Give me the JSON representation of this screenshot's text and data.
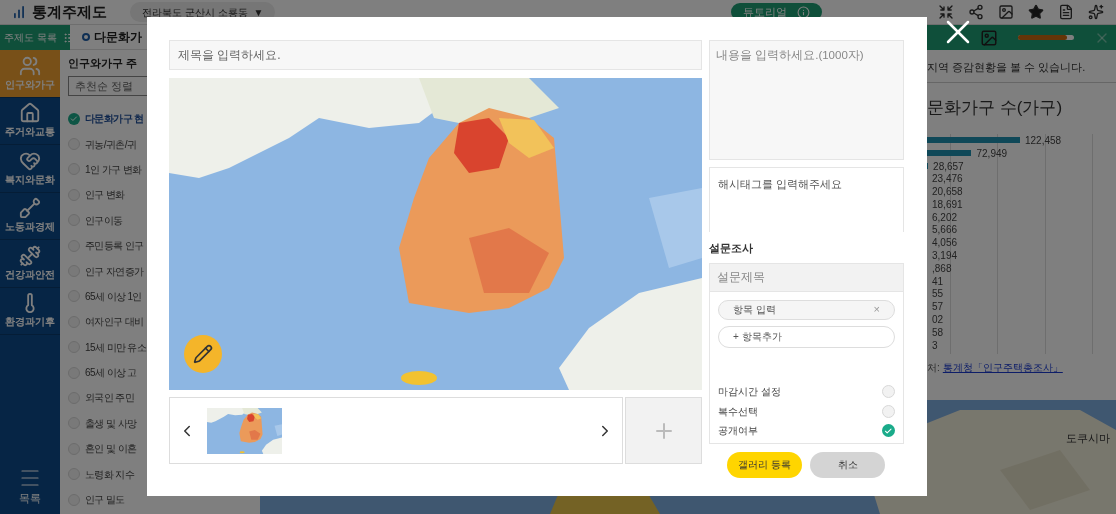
{
  "app": {
    "title": "통계주제도",
    "region": "전라북도 군산시 소룡동",
    "region_caret": "▼",
    "tutorial": "튜토리얼"
  },
  "nav": {
    "list_label": "주제도 목록",
    "tab": "다문화가",
    "menu": "목록",
    "categories": [
      {
        "label": "인구와가구",
        "selected": true,
        "kind": "people"
      },
      {
        "label": "주거와교통",
        "selected": false,
        "kind": "house"
      },
      {
        "label": "복지와문화",
        "selected": false,
        "kind": "welfare"
      },
      {
        "label": "노동과경제",
        "selected": false,
        "kind": "labor"
      },
      {
        "label": "건강과안전",
        "selected": false,
        "kind": "health"
      },
      {
        "label": "환경과기후",
        "selected": false,
        "kind": "climate"
      }
    ]
  },
  "theme_list": {
    "heading": "인구와가구 주",
    "sort": "추천순 정렬",
    "items": [
      {
        "label": "다문화가구 현",
        "checked": true
      },
      {
        "label": "귀농/귀촌/귀",
        "checked": false
      },
      {
        "label": "1인 가구 변화",
        "checked": false
      },
      {
        "label": "인구 변화",
        "checked": false
      },
      {
        "label": "인구이동",
        "checked": false
      },
      {
        "label": "주민등록 인구",
        "checked": false
      },
      {
        "label": "인구 자연증가",
        "checked": false
      },
      {
        "label": "65세 이상 1인",
        "checked": false
      },
      {
        "label": "여자인구 대비",
        "checked": false
      },
      {
        "label": "15세 미만 유소",
        "checked": false
      },
      {
        "label": "65세 이상 고",
        "checked": false
      },
      {
        "label": "외국인 주민",
        "checked": false
      },
      {
        "label": "출생 및 사망",
        "checked": false
      },
      {
        "label": "혼인 및 이혼",
        "checked": false
      },
      {
        "label": "노령화 지수",
        "checked": false
      },
      {
        "label": "인구 밀도",
        "checked": false
      }
    ]
  },
  "info": {
    "opacity_slider": {
      "level": 0.88
    },
    "description": "지역 증감현황을 볼 수 있습니다.",
    "chart_title": "문화가구 수(가구)",
    "value_labels": [
      "122,458",
      "72,949",
      "28,657",
      "23,476",
      "20,658",
      "18,691",
      "6,202",
      "5,666",
      "4,056",
      "3,194",
      ",868",
      "41",
      "55",
      "57",
      "02",
      "58",
      "3"
    ],
    "source_label": "처:",
    "source_link": "통계청「인구주택총조사」",
    "map_label": "도쿠시마"
  },
  "modal": {
    "title_placeholder": "제목을 입력하세요.",
    "content_placeholder": "내용을 입력하세요.(1000자)",
    "hashtag_placeholder": "해시태그를 입력해주세요",
    "survey": {
      "heading": "설문조사",
      "title_placeholder": "설문제목",
      "option_placeholder": "항목 입력",
      "option_remove": "×",
      "add_option": "+ 항목추가",
      "settings": [
        {
          "label": "마감시간 설정",
          "checked": false
        },
        {
          "label": "복수선택",
          "checked": false
        },
        {
          "label": "공개여부",
          "checked": true
        }
      ]
    },
    "submit": "갤러리 등록",
    "cancel": "취소"
  }
}
